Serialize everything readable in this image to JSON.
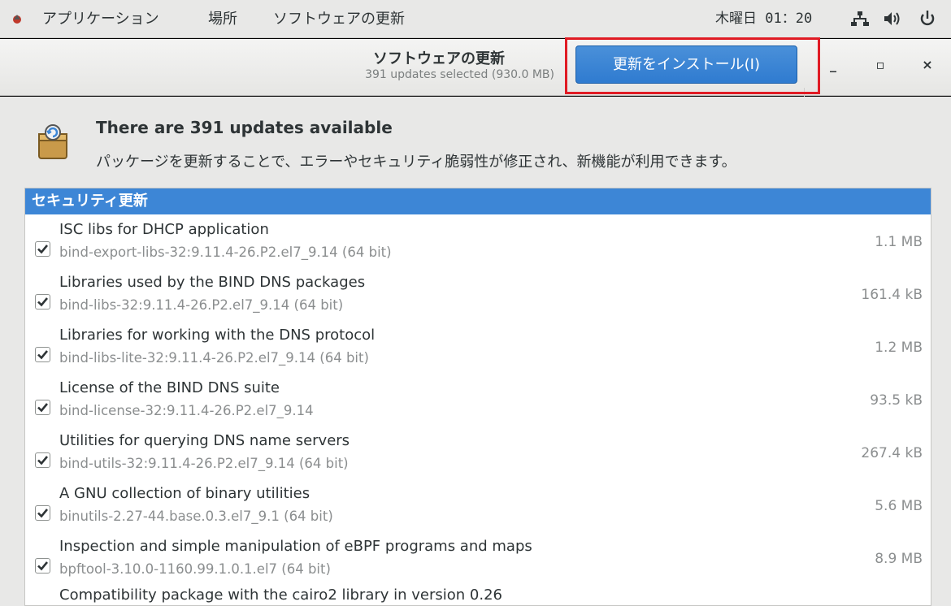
{
  "topbar": {
    "apps_label": "アプリケーション",
    "places_label": "場所",
    "app_menu_label": "ソフトウェアの更新",
    "clock": "木曜日 01：20"
  },
  "headerbar": {
    "title": "ソフトウェアの更新",
    "subtitle": "391 updates selected (930.0 MB)",
    "install_label": "更新をインストール(I)",
    "minimize_label": "_",
    "maximize_label": "▫",
    "close_label": "×"
  },
  "banner": {
    "title": "There are 391 updates available",
    "description": "パッケージを更新することで、エラーやセキュリティ脆弱性が修正され、新機能が利用できます。"
  },
  "list": {
    "section_title": "セキュリティ更新",
    "items": [
      {
        "name": "ISC libs for DHCP application",
        "package": "bind-export-libs-32:9.11.4-26.P2.el7_9.14 (64 bit)",
        "size": "1.1 MB"
      },
      {
        "name": "Libraries used by the BIND DNS packages",
        "package": "bind-libs-32:9.11.4-26.P2.el7_9.14 (64 bit)",
        "size": "161.4 kB"
      },
      {
        "name": "Libraries for working with the DNS protocol",
        "package": "bind-libs-lite-32:9.11.4-26.P2.el7_9.14 (64 bit)",
        "size": "1.2 MB"
      },
      {
        "name": "License of the BIND DNS suite",
        "package": "bind-license-32:9.11.4-26.P2.el7_9.14",
        "size": "93.5 kB"
      },
      {
        "name": "Utilities for querying DNS name servers",
        "package": "bind-utils-32:9.11.4-26.P2.el7_9.14 (64 bit)",
        "size": "267.4 kB"
      },
      {
        "name": "A GNU collection of binary utilities",
        "package": "binutils-2.27-44.base.0.3.el7_9.1 (64 bit)",
        "size": "5.6 MB"
      },
      {
        "name": "Inspection and simple manipulation of eBPF programs and maps",
        "package": "bpftool-3.10.0-1160.99.1.0.1.el7 (64 bit)",
        "size": "8.9 MB"
      }
    ],
    "partial_item": "Compatibility package with the cairo2 library in version 0.26"
  }
}
